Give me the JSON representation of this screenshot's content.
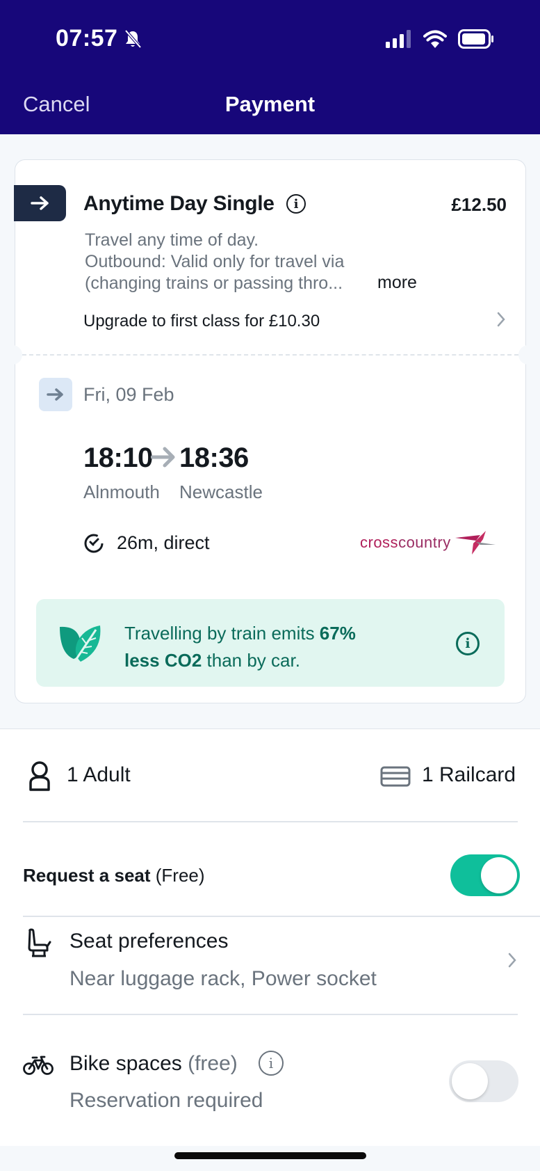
{
  "status_bar": {
    "time": "07:57"
  },
  "nav": {
    "cancel": "Cancel",
    "title": "Payment"
  },
  "ticket": {
    "fare_name": "Anytime Day Single",
    "price": "£12.50",
    "description_line1": "Travel any time of day.",
    "description_line2": "Outbound: Valid only for travel via",
    "description_line3": "(changing trains or passing thro...",
    "more": "more",
    "upgrade": "Upgrade to first class for £10.30"
  },
  "journey": {
    "date": "Fri, 09 Feb",
    "departure_time": "18:10",
    "arrival_time": "18:36",
    "departure_station": "Alnmouth",
    "arrival_station": "Newcastle",
    "duration": "26m, direct",
    "operator_part1": "cross",
    "operator_part2": "country"
  },
  "co2": {
    "text_start": "Travelling by train emits ",
    "highlight1": "67%",
    "highlight2": "less CO2",
    "text_end": " than by car."
  },
  "options": {
    "passengers": "1 Adult",
    "railcards": "1 Railcard",
    "seat_request_label": "Request a seat",
    "seat_request_price": " (Free)",
    "seat_request_on": true,
    "seat_pref_title": "Seat preferences",
    "seat_pref_value": "Near luggage rack, Power socket",
    "bike_title": "Bike spaces",
    "bike_free": " (free)",
    "bike_sub": "Reservation required",
    "bike_on": false
  },
  "colors": {
    "header": "#17077a",
    "toggle_on": "#0fbf9b",
    "co2_bg": "#e1f6f0",
    "co2_text": "#0a6b5a",
    "operator": "#b01f5a"
  },
  "icons": [
    "bell-slash-icon",
    "signal-icon",
    "wifi-icon",
    "battery-icon",
    "arrow-right-icon",
    "info-icon",
    "chevron-right-icon",
    "timer-icon",
    "leaf-icon",
    "person-icon",
    "railcard-icon",
    "seat-icon",
    "bike-icon"
  ]
}
